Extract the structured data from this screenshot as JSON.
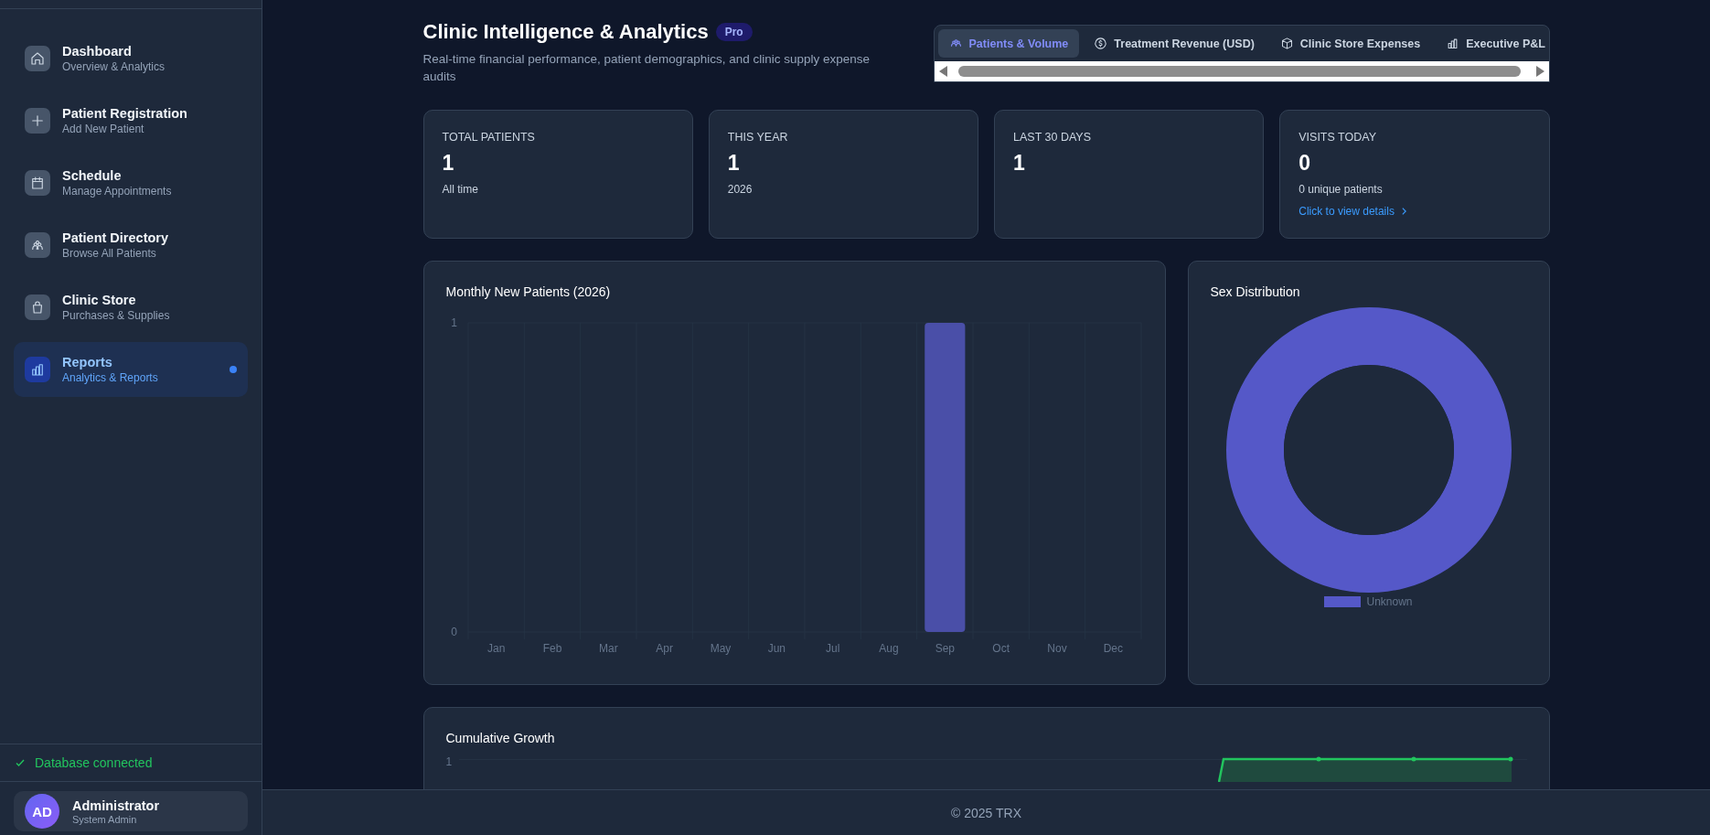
{
  "sidebar": {
    "items": [
      {
        "title": "Dashboard",
        "subtitle": "Overview & Analytics",
        "selected": false
      },
      {
        "title": "Patient Registration",
        "subtitle": "Add New Patient",
        "selected": false
      },
      {
        "title": "Schedule",
        "subtitle": "Manage Appointments",
        "selected": false
      },
      {
        "title": "Patient Directory",
        "subtitle": "Browse All Patients",
        "selected": false
      },
      {
        "title": "Clinic Store",
        "subtitle": "Purchases & Supplies",
        "selected": false
      },
      {
        "title": "Reports",
        "subtitle": "Analytics & Reports",
        "selected": true
      }
    ],
    "status": "Database connected",
    "user": {
      "initials": "AD",
      "name": "Administrator",
      "role": "System Admin"
    }
  },
  "header": {
    "title": "Clinic Intelligence & Analytics",
    "badge": "Pro",
    "subtitle": "Real-time financial performance, patient demographics, and clinic supply expense audits"
  },
  "tabs": [
    {
      "label": "Patients & Volume",
      "selected": true
    },
    {
      "label": "Treatment Revenue (USD)",
      "selected": false
    },
    {
      "label": "Clinic Store Expenses",
      "selected": false
    },
    {
      "label": "Executive P&L",
      "selected": false
    }
  ],
  "stats": [
    {
      "label": "TOTAL PATIENTS",
      "value": "1",
      "note": "All time"
    },
    {
      "label": "THIS YEAR",
      "value": "1",
      "note": "2026"
    },
    {
      "label": "LAST 30 DAYS",
      "value": "1"
    },
    {
      "label": "VISITS TODAY",
      "value": "0",
      "note": "0 unique patients",
      "link": "Click to view details"
    }
  ],
  "monthly_chart": {
    "chart_data": {
      "type": "bar",
      "title": "Monthly New Patients (2026)",
      "categories": [
        "Jan",
        "Feb",
        "Mar",
        "Apr",
        "May",
        "Jun",
        "Jul",
        "Aug",
        "Sep",
        "Oct",
        "Nov",
        "Dec"
      ],
      "series": [
        {
          "color": "#4a4fa8",
          "values": [
            0,
            0,
            0,
            0,
            0,
            0,
            0,
            0,
            1,
            0,
            0,
            0
          ]
        }
      ],
      "ylim": [
        0,
        1
      ],
      "yticks": [
        0,
        1
      ]
    }
  },
  "sex_chart": {
    "chart_data": {
      "type": "donut",
      "title": "Sex Distribution",
      "categories": [
        "Unknown"
      ],
      "series": [
        {
          "color": "#5558c8",
          "values": [
            100
          ]
        }
      ]
    }
  },
  "growth_chart": {
    "title": "Cumulative Growth",
    "ytick": "1"
  },
  "footer": "© 2025 TRX"
}
